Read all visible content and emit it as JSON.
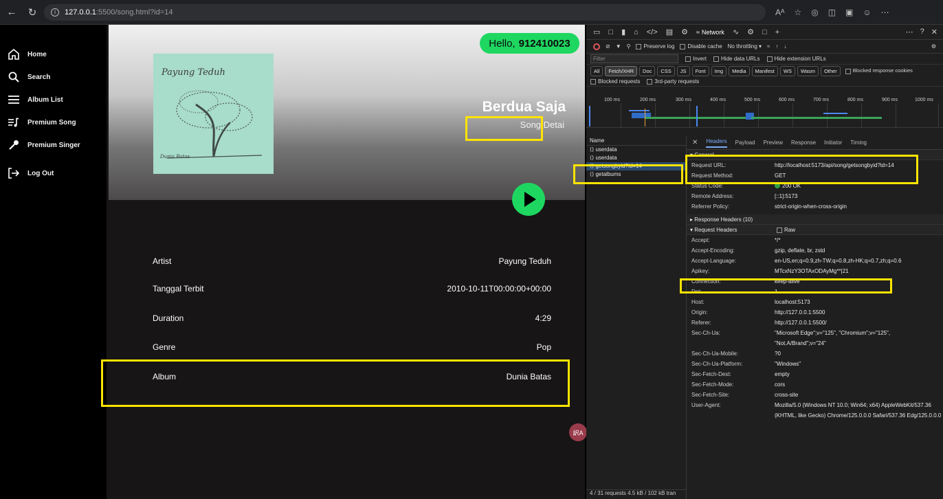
{
  "browser": {
    "url_host": "127.0.0.1",
    "url_path": ":5500/song.html?id=14",
    "read_aloud": "Aᴬ"
  },
  "sidebar": {
    "items": [
      {
        "label": "Home",
        "icon": "home-icon"
      },
      {
        "label": "Search",
        "icon": "search-icon"
      },
      {
        "label": "Album List",
        "icon": "list-icon"
      },
      {
        "label": "Premium Song",
        "icon": "music-list-icon"
      },
      {
        "label": "Premium Singer",
        "icon": "microphone-icon"
      },
      {
        "label": "Log Out",
        "icon": "logout-icon"
      }
    ]
  },
  "main": {
    "greeting": "Hello,",
    "username": "912410023",
    "cover_title": "Payung Teduh",
    "cover_subtitle": "Dunia Batas",
    "song_title": "Berdua Saja",
    "song_subtitle": "Song Detai",
    "details": [
      {
        "label": "Artist",
        "value": "Payung Teduh"
      },
      {
        "label": "Tanggal Terbit",
        "value": "2010-10-11T00:00:00+00:00"
      },
      {
        "label": "Duration",
        "value": "4:29"
      },
      {
        "label": "Genre",
        "value": "Pop"
      },
      {
        "label": "Album",
        "value": "Dunia Batas"
      }
    ],
    "translate_badge": "訳A"
  },
  "devtools": {
    "active_tab": "Network",
    "toolbar": {
      "preserve_log": "Preserve log",
      "disable_cache": "Disable cache",
      "throttling": "No throttling"
    },
    "filter_placeholder": "Filter",
    "filter_options": [
      "Invert",
      "Hide data URLs",
      "Hide extension URLs"
    ],
    "type_filters": [
      "All",
      "Fetch/XHR",
      "Doc",
      "CSS",
      "JS",
      "Font",
      "Img",
      "Media",
      "Manifest",
      "WS",
      "Wasm",
      "Other"
    ],
    "active_type_filter": "Fetch/XHR",
    "blocked_cookies": "Blocked response cookies",
    "blocked_requests": "Blocked requests",
    "third_party": "3rd-party requests",
    "timeline_ticks": [
      "100 ms",
      "200 ms",
      "300 ms",
      "400 ms",
      "500 ms",
      "600 ms",
      "700 ms",
      "800 ms",
      "900 ms",
      "1000 ms"
    ],
    "name_header": "Name",
    "requests": [
      "userdata",
      "userdata",
      "getsongbyid?id=14",
      "getalbums"
    ],
    "selected_request": "getsongbyid?id=14",
    "footer": "4 / 31 requests  4.5 kB / 102 kB tran",
    "detail_tabs": [
      "Headers",
      "Payload",
      "Preview",
      "Response",
      "Initiator",
      "Timing"
    ],
    "active_detail_tab": "Headers",
    "general_label": "▾ General",
    "general": [
      {
        "k": "Request URL:",
        "v": "http://localhost:5173/api/song/getsongbyid?id=14"
      },
      {
        "k": "Request Method:",
        "v": "GET"
      },
      {
        "k": "Status Code:",
        "v": "200 OK"
      },
      {
        "k": "Remote Address:",
        "v": "[::1]:5173"
      },
      {
        "k": "Referrer Policy:",
        "v": "strict-origin-when-cross-origin"
      }
    ],
    "response_headers_label": "▸ Response Headers (10)",
    "request_headers_label": "▾ Request Headers",
    "raw_label": "Raw",
    "request_headers": [
      {
        "k": "Accept:",
        "v": "*/*"
      },
      {
        "k": "Accept-Encoding:",
        "v": "gzip, deflate, br, zstd"
      },
      {
        "k": "Accept-Language:",
        "v": "en-US,en;q=0.9,zh-TW;q=0.8,zh-HK;q=0.7,zh;q=0.6"
      },
      {
        "k": "Apikey:",
        "v": "MTcxNzY3OTAxODAyMg**|21"
      },
      {
        "k": "Connection:",
        "v": "keep-alive"
      },
      {
        "k": "Dnt:",
        "v": "1"
      },
      {
        "k": "Host:",
        "v": "localhost:5173"
      },
      {
        "k": "Origin:",
        "v": "http://127.0.0.1:5500"
      },
      {
        "k": "Referer:",
        "v": "http://127.0.0.1:5500/"
      },
      {
        "k": "Sec-Ch-Ua:",
        "v": "\"Microsoft Edge\";v=\"125\", \"Chromium\";v=\"125\", \"Not.A/Brand\";v=\"24\""
      },
      {
        "k": "Sec-Ch-Ua-Mobile:",
        "v": "?0"
      },
      {
        "k": "Sec-Ch-Ua-Platform:",
        "v": "\"Windows\""
      },
      {
        "k": "Sec-Fetch-Dest:",
        "v": "empty"
      },
      {
        "k": "Sec-Fetch-Mode:",
        "v": "cors"
      },
      {
        "k": "Sec-Fetch-Site:",
        "v": "cross-site"
      },
      {
        "k": "User-Agent:",
        "v": "Mozilla/5.0 (Windows NT 10.0; Win64; x64) AppleWebKit/537.36 (KHTML, like Gecko) Chrome/125.0.0.0 Safari/537.36 Edg/125.0.0.0"
      }
    ]
  },
  "colors": {
    "accent_green": "#1ed760",
    "highlight_yellow": "#ffe400",
    "devtools_bg": "#1f1f1f"
  }
}
